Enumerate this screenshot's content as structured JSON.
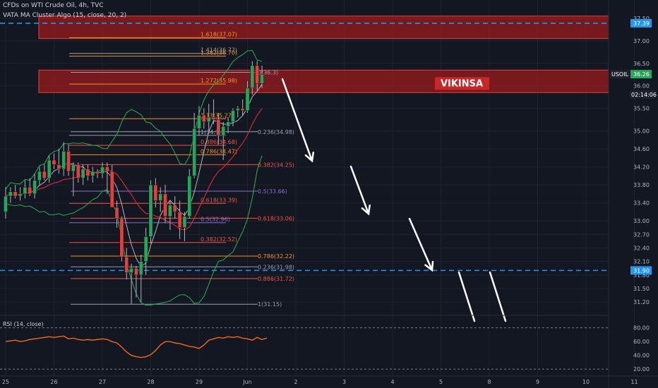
{
  "header": {
    "symbol_line": "CFDs on WTI Crude Oil, 4h, TVC",
    "indicator_line": "VATA MA Cluster Algo (15, close, 20, 2)",
    "rsi_label": "RSI (14, close)"
  },
  "colors": {
    "background": "#131722",
    "up_candle": "#26a65b",
    "down_candle": "#e0413f",
    "resistance_zone": "#9b1c1c",
    "dashed_level": "#2196f3",
    "rsi_line": "#f2691b",
    "fib_orange": "#f7931e",
    "fib_red": "#f05545",
    "fib_gray": "#9aa0ab",
    "fib_purple": "#8c6bd6",
    "ma_green": "#23b14d",
    "ma_red": "#d3282f",
    "ma_gray": "#b2b5be"
  },
  "chart_data": {
    "type": "candlestick",
    "price_axis": {
      "ylim": [
        30.95,
        37.75
      ],
      "ticks": [
        "37.50",
        "37.00",
        "36.50",
        "36.00",
        "35.50",
        "35.00",
        "34.60",
        "34.20",
        "33.80",
        "33.40",
        "33.00",
        "32.70",
        "32.40",
        "32.10",
        "31.80",
        "31.50",
        "31.20"
      ]
    },
    "time_axis": {
      "labels": [
        "25",
        "26",
        "27",
        "28",
        "29",
        "Jun",
        "2",
        "3",
        "4",
        "5",
        "8",
        "9",
        "10",
        "11"
      ],
      "label_bar_index": [
        0,
        10,
        20,
        30,
        40,
        50,
        60,
        70,
        80,
        90,
        100,
        110,
        120,
        130
      ]
    },
    "candles": [
      {
        "o": 33.2,
        "h": 33.75,
        "l": 33.05,
        "c": 33.55
      },
      {
        "o": 33.55,
        "h": 33.75,
        "l": 33.4,
        "c": 33.65
      },
      {
        "o": 33.65,
        "h": 33.8,
        "l": 33.5,
        "c": 33.55
      },
      {
        "o": 33.55,
        "h": 33.75,
        "l": 33.45,
        "c": 33.6
      },
      {
        "o": 33.6,
        "h": 33.9,
        "l": 33.5,
        "c": 33.75
      },
      {
        "o": 33.75,
        "h": 33.95,
        "l": 33.55,
        "c": 33.6
      },
      {
        "o": 33.6,
        "h": 34.05,
        "l": 33.5,
        "c": 33.9
      },
      {
        "o": 33.9,
        "h": 34.2,
        "l": 33.8,
        "c": 34.1
      },
      {
        "o": 34.1,
        "h": 34.25,
        "l": 33.9,
        "c": 33.95
      },
      {
        "o": 33.95,
        "h": 34.45,
        "l": 33.85,
        "c": 34.35
      },
      {
        "o": 34.35,
        "h": 34.5,
        "l": 34.15,
        "c": 34.25
      },
      {
        "o": 34.25,
        "h": 34.6,
        "l": 34.05,
        "c": 34.15
      },
      {
        "o": 34.15,
        "h": 34.75,
        "l": 34.0,
        "c": 34.55
      },
      {
        "o": 34.55,
        "h": 34.7,
        "l": 34.0,
        "c": 34.1
      },
      {
        "o": 34.1,
        "h": 34.3,
        "l": 33.55,
        "c": 34.25
      },
      {
        "o": 34.25,
        "h": 34.3,
        "l": 33.85,
        "c": 33.95
      },
      {
        "o": 33.95,
        "h": 34.25,
        "l": 33.8,
        "c": 34.15
      },
      {
        "o": 34.15,
        "h": 34.25,
        "l": 33.9,
        "c": 34.0
      },
      {
        "o": 34.0,
        "h": 34.2,
        "l": 33.85,
        "c": 34.1
      },
      {
        "o": 34.1,
        "h": 34.15,
        "l": 33.95,
        "c": 34.05
      },
      {
        "o": 34.05,
        "h": 34.3,
        "l": 33.95,
        "c": 34.2
      },
      {
        "o": 34.2,
        "h": 34.3,
        "l": 33.6,
        "c": 34.1
      },
      {
        "o": 34.1,
        "h": 34.25,
        "l": 33.85,
        "c": 33.3
      },
      {
        "o": 33.3,
        "h": 33.45,
        "l": 32.85,
        "c": 33.05
      },
      {
        "o": 33.05,
        "h": 33.1,
        "l": 32.1,
        "c": 32.2
      },
      {
        "o": 32.2,
        "h": 32.4,
        "l": 31.7,
        "c": 31.85
      },
      {
        "o": 31.85,
        "h": 32.05,
        "l": 31.15,
        "c": 31.95
      },
      {
        "o": 31.95,
        "h": 32.0,
        "l": 31.3,
        "c": 31.8
      },
      {
        "o": 31.8,
        "h": 32.25,
        "l": 31.2,
        "c": 32.1
      },
      {
        "o": 32.1,
        "h": 32.85,
        "l": 31.8,
        "c": 32.65
      },
      {
        "o": 32.65,
        "h": 33.9,
        "l": 32.5,
        "c": 33.8
      },
      {
        "o": 33.8,
        "h": 33.95,
        "l": 33.3,
        "c": 33.45
      },
      {
        "o": 33.45,
        "h": 33.75,
        "l": 33.2,
        "c": 33.6
      },
      {
        "o": 33.6,
        "h": 33.8,
        "l": 32.95,
        "c": 33.1
      },
      {
        "o": 33.1,
        "h": 33.45,
        "l": 32.8,
        "c": 33.35
      },
      {
        "o": 33.35,
        "h": 33.55,
        "l": 33.05,
        "c": 33.2
      },
      {
        "o": 33.2,
        "h": 33.45,
        "l": 32.6,
        "c": 32.85
      },
      {
        "o": 32.85,
        "h": 33.2,
        "l": 32.55,
        "c": 33.1
      },
      {
        "o": 33.1,
        "h": 34.15,
        "l": 33.05,
        "c": 34.0
      },
      {
        "o": 34.0,
        "h": 35.4,
        "l": 33.95,
        "c": 35.05
      },
      {
        "o": 35.05,
        "h": 35.55,
        "l": 34.9,
        "c": 35.35
      },
      {
        "o": 35.35,
        "h": 35.5,
        "l": 35.05,
        "c": 35.2
      },
      {
        "o": 35.2,
        "h": 35.6,
        "l": 35.0,
        "c": 35.3
      },
      {
        "o": 35.3,
        "h": 35.7,
        "l": 35.15,
        "c": 35.25
      },
      {
        "o": 35.25,
        "h": 35.4,
        "l": 34.7,
        "c": 34.9
      },
      {
        "o": 34.9,
        "h": 35.2,
        "l": 34.35,
        "c": 35.1
      },
      {
        "o": 35.1,
        "h": 35.3,
        "l": 34.95,
        "c": 35.2
      },
      {
        "o": 35.2,
        "h": 35.5,
        "l": 35.1,
        "c": 35.45
      },
      {
        "o": 35.45,
        "h": 35.55,
        "l": 35.3,
        "c": 35.5
      },
      {
        "o": 35.5,
        "h": 35.7,
        "l": 35.35,
        "c": 35.45
      },
      {
        "o": 35.45,
        "h": 36.1,
        "l": 35.4,
        "c": 35.95
      },
      {
        "o": 35.95,
        "h": 36.55,
        "l": 35.8,
        "c": 36.45
      },
      {
        "o": 36.45,
        "h": 36.55,
        "l": 35.9,
        "c": 36.05
      },
      {
        "o": 36.05,
        "h": 36.45,
        "l": 35.95,
        "c": 36.26
      }
    ],
    "resistance_zones": [
      {
        "top": 37.55,
        "bottom": 37.05
      },
      {
        "top": 36.35,
        "bottom": 35.85
      }
    ],
    "zone_label": "VIKINSA",
    "dashed_levels": [
      37.39,
      31.9
    ],
    "fib_upper": [
      {
        "label": "1.618(37.07)",
        "value": 37.07,
        "color": "orange"
      },
      {
        "label": "1.414(36.72)",
        "value": 36.72,
        "color": "gray"
      },
      {
        "label": "1.382(36.70)",
        "value": 36.66,
        "color": "orange"
      },
      {
        "label": "1.272(35.98)",
        "value": 36.04,
        "color": "orange"
      },
      {
        "label": "1.13(35.27)",
        "value": 35.27,
        "color": "orange"
      },
      {
        "label": "1(34.9)",
        "value": 34.9,
        "color": "gray"
      },
      {
        "label": "0.886(34.68)",
        "value": 34.68,
        "color": "red"
      },
      {
        "label": "0.786(34.47)",
        "value": 34.47,
        "color": "orange"
      },
      {
        "label": "0.618(33.39)",
        "value": 33.39,
        "color": "red"
      },
      {
        "label": "0.5(32.96)",
        "value": 32.96,
        "color": "purple"
      },
      {
        "label": "0.382(32.52)",
        "value": 32.52,
        "color": "red"
      }
    ],
    "fib_lower": [
      {
        "label": "0(36.3)",
        "value": 36.3,
        "color": "gray"
      },
      {
        "label": "0.236(34.98)",
        "value": 34.98,
        "color": "gray"
      },
      {
        "label": "0.382(34.25)",
        "value": 34.25,
        "color": "red"
      },
      {
        "label": "0.5(33.66)",
        "value": 33.66,
        "color": "purple"
      },
      {
        "label": "0.618(33.06)",
        "value": 33.06,
        "color": "red"
      },
      {
        "label": "0.786(32.22)",
        "value": 32.22,
        "color": "orange"
      },
      {
        "label": "0.236(31.98)",
        "value": 31.98,
        "color": "gray"
      },
      {
        "label": "0.886(31.72)",
        "value": 31.72,
        "color": "red"
      },
      {
        "label": "1(31.15)",
        "value": 31.15,
        "color": "gray"
      }
    ],
    "price_badges": [
      {
        "label": "37.39",
        "value": 37.39,
        "style": "blue"
      },
      {
        "label": "USOIL",
        "value": 36.26,
        "style": "dark"
      },
      {
        "label": "36.26",
        "value": 36.26,
        "style": "green"
      },
      {
        "label": "02:14:06",
        "value": 35.98,
        "style": "dark"
      },
      {
        "label": "31.90",
        "value": 31.9,
        "style": "blue"
      }
    ],
    "rsi": {
      "ticks": [
        "80.00",
        "60.00",
        "40.00",
        "20.00"
      ],
      "ylim": [
        10,
        95
      ],
      "bands": [
        80,
        20
      ],
      "values": [
        60,
        61,
        62,
        60,
        61,
        63,
        64,
        65,
        66,
        67,
        66,
        67,
        68,
        64,
        65,
        63,
        62,
        63,
        62,
        63,
        64,
        63,
        60,
        58,
        52,
        45,
        40,
        38,
        37,
        38,
        41,
        47,
        55,
        60,
        60,
        58,
        57,
        55,
        53,
        52,
        50,
        55,
        62,
        64,
        66,
        65,
        67,
        66,
        67,
        65,
        64,
        62,
        66,
        63,
        65
      ]
    }
  }
}
